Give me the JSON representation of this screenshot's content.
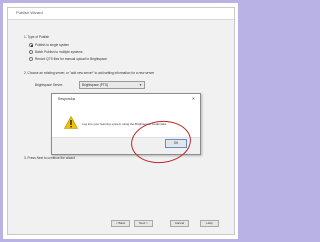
{
  "wizard": {
    "title": "Publish Wizard",
    "step1": "1. Type of Publish",
    "options": [
      "Publish to single system",
      "Batch Publish to multiple systems",
      "Record QTS files for manual upload to Brightspace"
    ],
    "step2": "2. Choose an existing server, or \"add new server\" to add setting information for a new server",
    "server_label": "Brightspace Server:",
    "server_value": "Brightspace (PTS)",
    "step3": "3. Press Next to continue the wizard",
    "buttons": {
      "back": "< Back",
      "next": "Next >",
      "cancel": "Cancel",
      "help": "Help"
    }
  },
  "dialog": {
    "title": "Respondus",
    "message": "Log into your learning system using the Brightspace credentials.",
    "ok": "OK"
  },
  "colors": {
    "background": "#b9b2e4",
    "annotation": "#c0262b",
    "warning": "#f2c200"
  }
}
